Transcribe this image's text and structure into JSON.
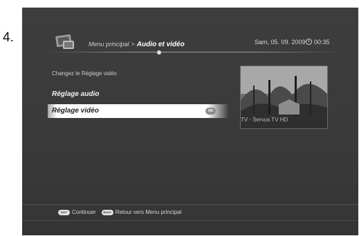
{
  "step_number": "4.",
  "header": {
    "breadcrumb_root": "Menu principal",
    "breadcrumb_separator": ">",
    "breadcrumb_current": "Audio et vidéo",
    "date": "Sam, 05. 09. 2009",
    "time": "00:35"
  },
  "hint": "Changez le Réglage vidéo",
  "menu": {
    "items": [
      {
        "label": "Réglage audio",
        "selected": false
      },
      {
        "label": "Réglage vidéo",
        "selected": true,
        "badge": "OK"
      }
    ]
  },
  "preview": {
    "channel": "TV - Servus TV HD"
  },
  "footer": {
    "exit_key": "EXIT",
    "exit_label": "Continuer",
    "back_key": "BACK",
    "back_label": "Retour vers Menu principal"
  },
  "colors": {
    "screen_bg": "#3a3a3a",
    "selection_bg": "#ffffff",
    "text": "#f2f2f2"
  }
}
